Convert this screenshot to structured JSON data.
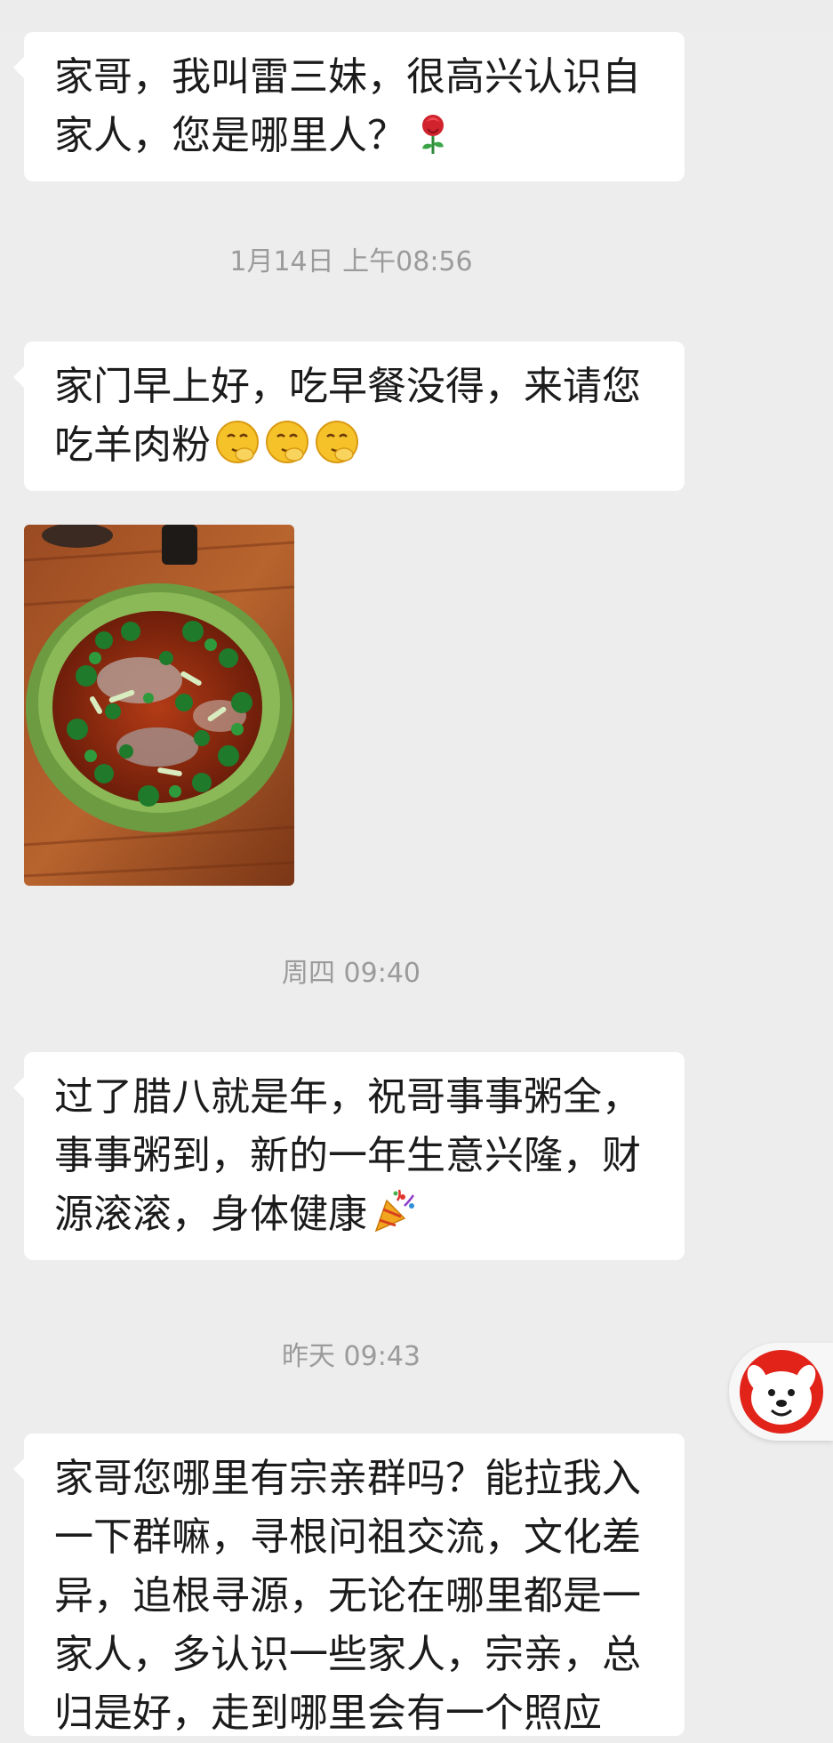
{
  "messages": [
    {
      "lines": [
        "家哥，我叫雷三妹，很高兴认识自",
        "家人，您是哪里人？"
      ],
      "emoji": "rose-icon"
    },
    {
      "lines": [
        "家门早上好，吃早餐没得，来请您",
        "吃羊肉粉"
      ],
      "emoji": "thinking-face-icon"
    },
    {
      "lines": [
        "过了腊八就是年，祝哥事事粥全，",
        "事事粥到，新的一年生意兴隆，财",
        "源滚滚，身体健康"
      ],
      "emoji": "party-popper-icon"
    },
    {
      "lines": [
        "家哥您哪里有宗亲群吗？能拉我入",
        "一下群嘛，寻根问祖交流，文化差",
        "异，追根寻源，无论在哪里都是一",
        "家人，多认识一些家人，宗亲，总",
        "归是好，走到哪里会有一个照应"
      ]
    }
  ],
  "timestamps": {
    "t1": "1月14日 上午08:56",
    "t2": "周四 09:40",
    "t3": "昨天 09:43"
  },
  "image": {
    "description_icon": "lamb-noodle-soup-photo"
  },
  "floating": {
    "icon": "jd-dog-mascot-icon"
  },
  "colors": {
    "background": "#ededed",
    "bubble": "#ffffff",
    "timestamp_text": "#9b9b9b"
  }
}
